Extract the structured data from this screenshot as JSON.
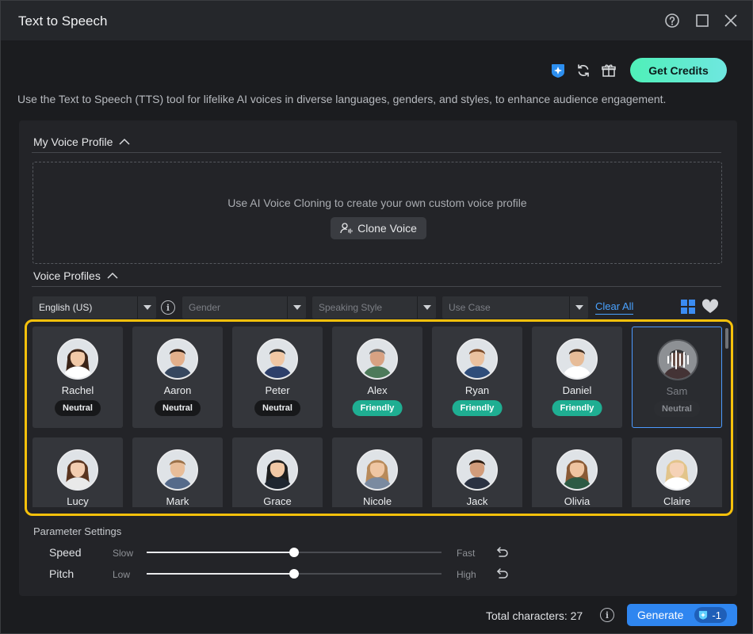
{
  "window": {
    "title": "Text to Speech"
  },
  "toolbar": {
    "get_credits_label": "Get Credits"
  },
  "description": "Use the Text to Speech (TTS) tool for lifelike AI voices in diverse languages, genders, and styles, to enhance audience engagement.",
  "my_voice_profile": {
    "heading": "My Voice Profile",
    "prompt": "Use AI Voice Cloning to create your own custom voice profile",
    "clone_button_label": "Clone Voice"
  },
  "voice_profiles": {
    "heading": "Voice Profiles",
    "filters": {
      "language": "English (US)",
      "gender_placeholder": "Gender",
      "style_placeholder": "Speaking Style",
      "usecase_placeholder": "Use Case",
      "clear_all": "Clear All"
    },
    "voices": [
      {
        "name": "Rachel",
        "tag": "Neutral",
        "tag_type": "neutral",
        "selected": false
      },
      {
        "name": "Aaron",
        "tag": "Neutral",
        "tag_type": "neutral",
        "selected": false
      },
      {
        "name": "Peter",
        "tag": "Neutral",
        "tag_type": "neutral",
        "selected": false
      },
      {
        "name": "Alex",
        "tag": "Friendly",
        "tag_type": "friendly",
        "selected": false
      },
      {
        "name": "Ryan",
        "tag": "Friendly",
        "tag_type": "friendly",
        "selected": false
      },
      {
        "name": "Daniel",
        "tag": "Friendly",
        "tag_type": "friendly",
        "selected": false
      },
      {
        "name": "Sam",
        "tag": "Neutral",
        "tag_type": "neutral",
        "selected": true
      },
      {
        "name": "Lucy",
        "tag": "",
        "tag_type": "neutral",
        "selected": false
      },
      {
        "name": "Mark",
        "tag": "",
        "tag_type": "neutral",
        "selected": false
      },
      {
        "name": "Grace",
        "tag": "",
        "tag_type": "neutral",
        "selected": false
      },
      {
        "name": "Nicole",
        "tag": "",
        "tag_type": "neutral",
        "selected": false
      },
      {
        "name": "Jack",
        "tag": "",
        "tag_type": "neutral",
        "selected": false
      },
      {
        "name": "Olivia",
        "tag": "",
        "tag_type": "neutral",
        "selected": false
      },
      {
        "name": "Claire",
        "tag": "",
        "tag_type": "neutral",
        "selected": false
      }
    ]
  },
  "parameters": {
    "heading": "Parameter Settings",
    "speed": {
      "label": "Speed",
      "low": "Slow",
      "high": "Fast",
      "value": 0.5
    },
    "pitch": {
      "label": "Pitch",
      "low": "Low",
      "high": "High",
      "value": 0.5
    }
  },
  "footer": {
    "total_label": "Total characters: 27",
    "generate_label": "Generate",
    "generate_cost": "-1"
  },
  "colors": {
    "accent": "#2f86f0",
    "credits_gradient_start": "#4ff0b8",
    "friendly_badge": "#1fae92",
    "highlight": "#f6c10b"
  }
}
